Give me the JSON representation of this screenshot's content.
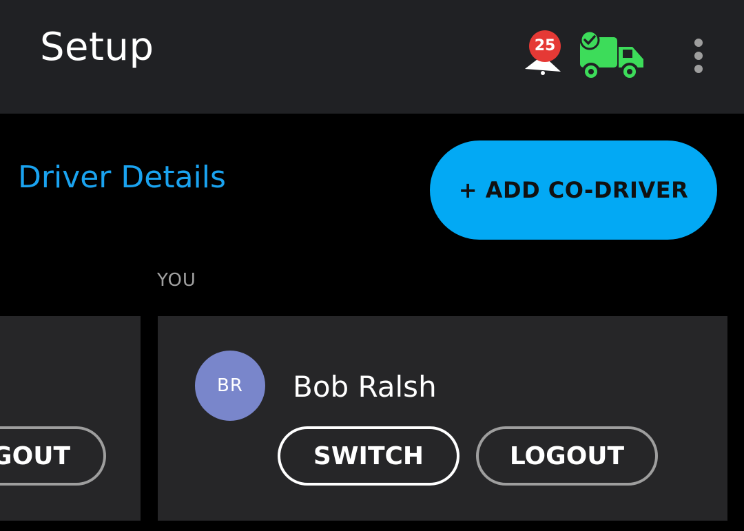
{
  "appbar": {
    "title": "Setup",
    "alert_count": "25",
    "alert_icon": "bell-alert-icon",
    "status_icon": "truck-check-icon",
    "menu_icon": "overflow-menu-icon"
  },
  "section": {
    "title": "Driver Details",
    "add_label": "+ ADD CO-DRIVER"
  },
  "drivers": [
    {
      "logout_label": "LOGOUT"
    },
    {
      "tag": "YOU",
      "initials": "BR",
      "name": "Bob Ralsh",
      "switch_label": "SWITCH",
      "logout_label": "LOGOUT"
    }
  ],
  "colors": {
    "appbar_bg": "#202124",
    "accent_blue": "#03a9f4",
    "title_blue": "#1aa3f0",
    "badge_red": "#e53935",
    "truck_green": "#3ddc5a",
    "avatar_bg": "#7986cb",
    "card_bg": "#262628"
  }
}
